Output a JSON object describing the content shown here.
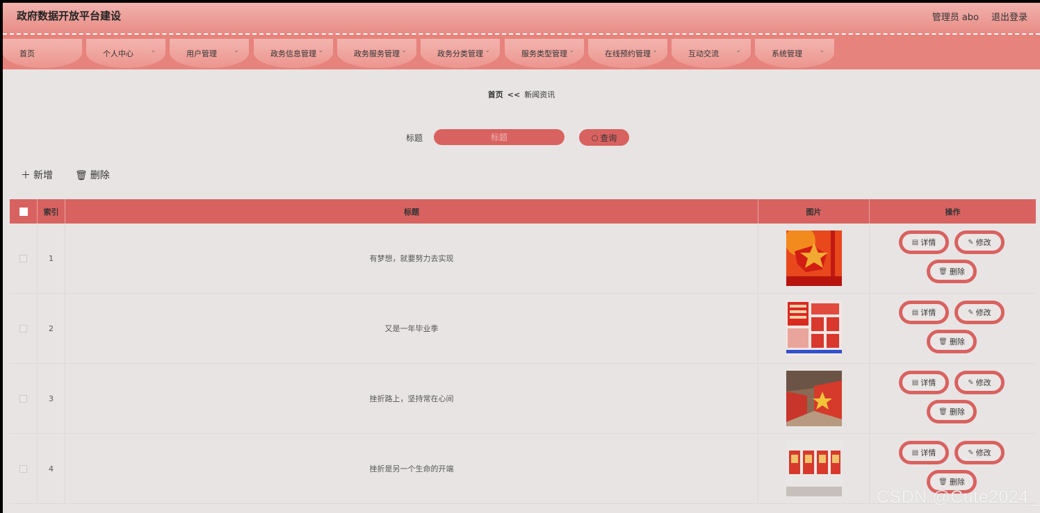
{
  "header": {
    "title": "政府数据开放平台建设",
    "user": "管理员 abo",
    "logout": "退出登录"
  },
  "nav": [
    {
      "label": "首页"
    },
    {
      "label": "个人中心"
    },
    {
      "label": "用户管理"
    },
    {
      "label": "政务信息管理"
    },
    {
      "label": "政务服务管理"
    },
    {
      "label": "政务分类管理"
    },
    {
      "label": "服务类型管理"
    },
    {
      "label": "在线预约管理"
    },
    {
      "label": "互动交流"
    },
    {
      "label": "系统管理"
    }
  ],
  "breadcrumb": {
    "home": "首页",
    "sep": "<<",
    "current": "新闻资讯"
  },
  "search": {
    "label": "标题",
    "placeholder": "标题",
    "button": "查询"
  },
  "toolbar": {
    "add": "新增",
    "delete": "删除"
  },
  "table": {
    "headers": {
      "index": "索引",
      "title": "标题",
      "image": "图片",
      "actions": "操作"
    },
    "rows": [
      {
        "index": "1",
        "title": "有梦想，就要努力去实现"
      },
      {
        "index": "2",
        "title": "又是一年毕业季"
      },
      {
        "index": "3",
        "title": "挫折路上，坚持常在心间"
      },
      {
        "index": "4",
        "title": "挫折是另一个生命的开端"
      }
    ],
    "actions": {
      "detail": "详情",
      "edit": "修改",
      "delete": "删除"
    }
  },
  "watermark": "CSDN @Cute2024_",
  "colors": {
    "accent": "#d86260",
    "header": "#ec958e",
    "background": "#e8e4e4"
  }
}
